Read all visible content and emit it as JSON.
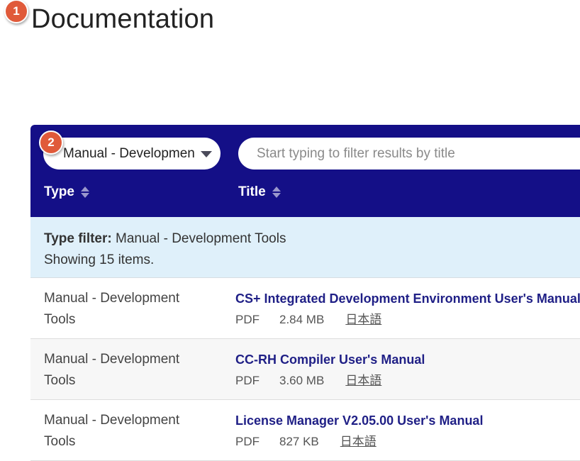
{
  "badges": {
    "b1": "1",
    "b2": "2"
  },
  "page": {
    "title": "Documentation"
  },
  "filters": {
    "type_select_value": "Manual - Development Tools",
    "search_placeholder": "Start typing to filter results by title"
  },
  "table": {
    "headers": {
      "type": "Type",
      "title": "Title"
    },
    "filter_info": {
      "label": "Type filter:",
      "value": "Manual - Development Tools",
      "showing": "Showing 15 items."
    },
    "rows": [
      {
        "type": "Manual - Development Tools",
        "title": "CS+ Integrated Development Environment User's Manual:",
        "format": "PDF",
        "size": "2.84 MB",
        "lang": "日本語"
      },
      {
        "type": "Manual - Development Tools",
        "title": "CC-RH Compiler User's Manual",
        "format": "PDF",
        "size": "3.60 MB",
        "lang": "日本語"
      },
      {
        "type": "Manual - Development Tools",
        "title": "License Manager V2.05.00 User's Manual",
        "format": "PDF",
        "size": "827 KB",
        "lang": "日本語"
      }
    ]
  },
  "colors": {
    "header_bg": "#140f87",
    "filter_info_bg": "#dff0fa",
    "link": "#1f1f86",
    "badge": "#e05a3a"
  },
  "icons": {
    "sort": "sort-arrows-icon",
    "dropdown": "caret-down-icon"
  }
}
